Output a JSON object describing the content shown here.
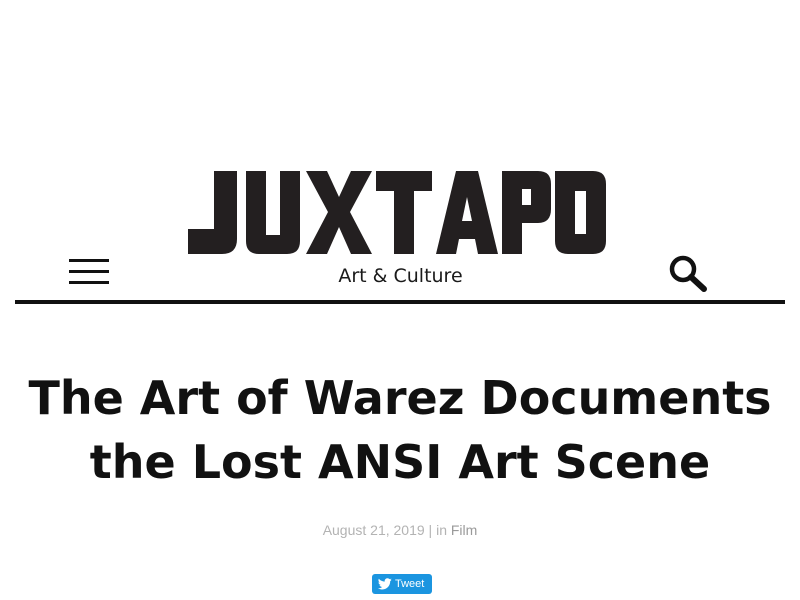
{
  "header": {
    "logo_text": "JUXTAPOZ",
    "tagline": "Art & Culture",
    "menu_icon": "hamburger-menu-icon",
    "search_icon": "search-icon"
  },
  "article": {
    "title": "The Art of Warez Documents the Lost ANSI Art Scene",
    "date": "August 21, 2019",
    "separator": " | in ",
    "category": "Film"
  },
  "share": {
    "tweet_label": "Tweet",
    "tweet_icon": "twitter-bird-icon"
  },
  "colors": {
    "text": "#111111",
    "meta": "#b3b3b3",
    "tweet_blue": "#1b95e0"
  }
}
